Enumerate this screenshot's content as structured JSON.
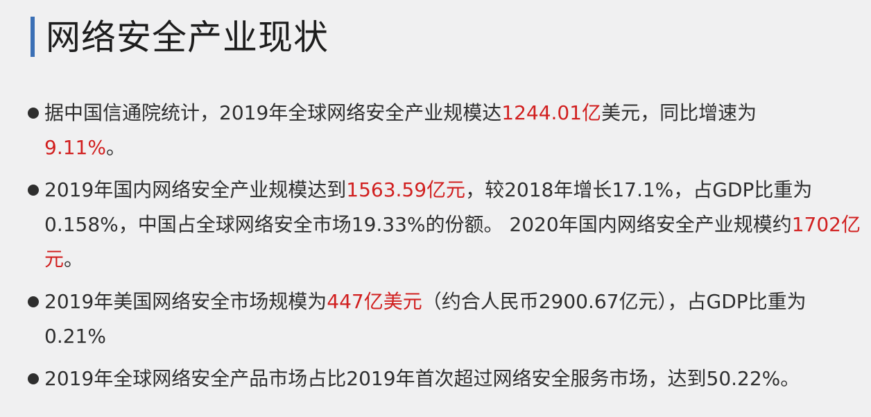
{
  "title": "网络安全产业现状",
  "colors": {
    "accent_bar": "#3a6fb5",
    "highlight": "#d11f1f",
    "text": "#2e2e2e",
    "background": "#f0f0f1"
  },
  "bullets": [
    {
      "p1": "据中国信通院统计，2019年全球网络安全产业规模达",
      "h1": "1244.01亿",
      "p2": "美元，同比增速为",
      "h2": "9.11%",
      "p3": "。"
    },
    {
      "p1": "2019年国内网络安全产业规模达到",
      "h1": "1563.59亿元",
      "p2": "，较2018年增长17.1%，占GDP比重为 0.158%，中国占全球网络安全市场19.33%的份额。 2020年国内网络安全产业规模约",
      "h2": "1702亿元",
      "p3": "。"
    },
    {
      "p1": "2019年美国网络安全市场规模为",
      "h1": "447亿美元",
      "p2": "（约合人民币2900.67亿元），占GDP比重为0.21%"
    },
    {
      "p1": "2019年全球网络安全产品市场占比2019年首次超过网络安全服务市场，达到50.22%。"
    }
  ]
}
